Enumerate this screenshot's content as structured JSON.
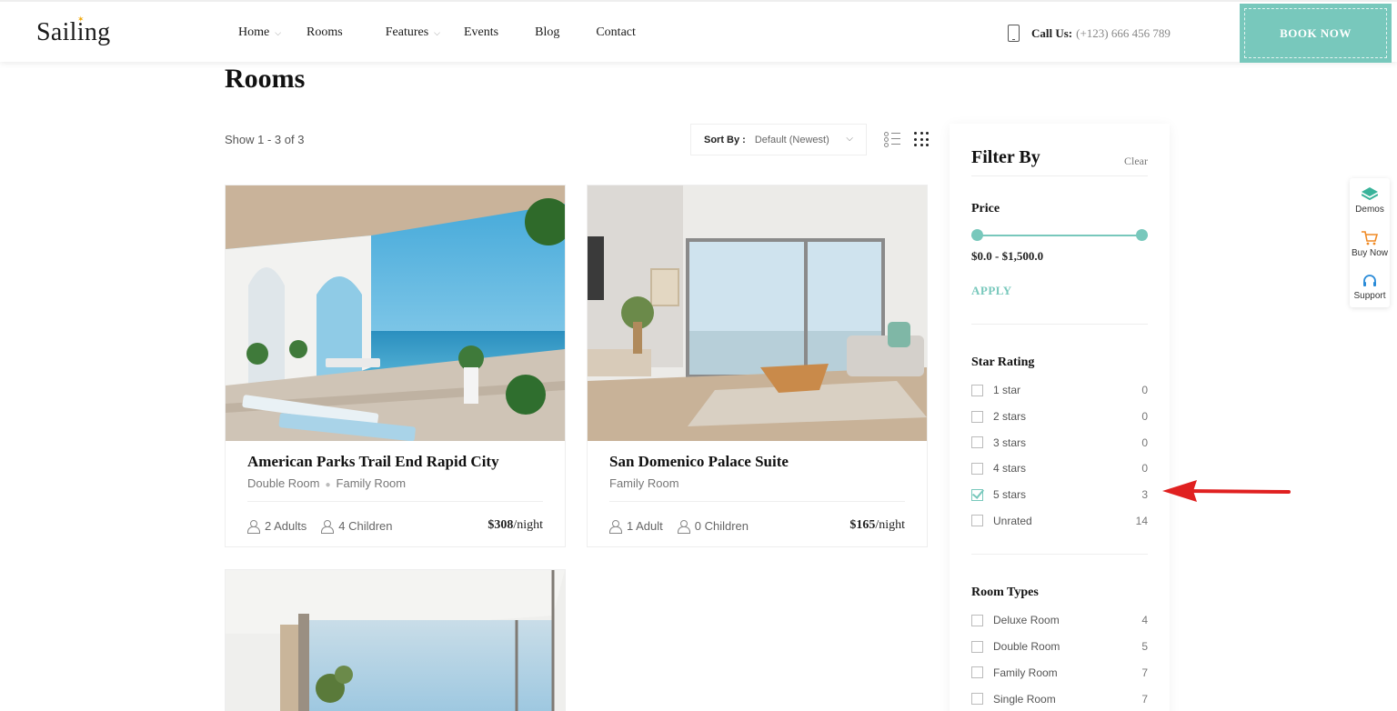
{
  "header": {
    "logo": "Sailing",
    "nav": [
      {
        "label": "Home",
        "dropdown": true
      },
      {
        "label": "Rooms",
        "dropdown": false
      },
      {
        "label": "Features",
        "dropdown": true
      },
      {
        "label": "Events",
        "dropdown": false
      },
      {
        "label": "Blog",
        "dropdown": false
      },
      {
        "label": "Contact",
        "dropdown": false
      }
    ],
    "call_label": "Call Us:",
    "call_number": "(+123) 666 456 789",
    "book_now": "BOOK NOW"
  },
  "page": {
    "title": "Rooms",
    "show_count": "Show 1 - 3 of 3",
    "sort_label": "Sort By :",
    "sort_value": "Default (Newest)"
  },
  "rooms": [
    {
      "title": "American Parks Trail End Rapid City",
      "types": [
        "Double Room",
        "Family Room"
      ],
      "adults": "2 Adults",
      "children": "4 Children",
      "price": "$308",
      "per": "/night"
    },
    {
      "title": "San Domenico Palace Suite",
      "types": [
        "Family Room"
      ],
      "adults": "1 Adult",
      "children": "0 Children",
      "price": "$165",
      "per": "/night"
    }
  ],
  "filter": {
    "title": "Filter By",
    "clear": "Clear",
    "price": {
      "title": "Price",
      "range": "$0.0 - $1,500.0",
      "apply": "APPLY",
      "min_fraction": 0,
      "max_fraction": 1
    },
    "star_rating": {
      "title": "Star Rating",
      "options": [
        {
          "label": "1 star",
          "count": "0",
          "checked": false
        },
        {
          "label": "2 stars",
          "count": "0",
          "checked": false
        },
        {
          "label": "3 stars",
          "count": "0",
          "checked": false
        },
        {
          "label": "4 stars",
          "count": "0",
          "checked": false
        },
        {
          "label": "5 stars",
          "count": "3",
          "checked": true
        },
        {
          "label": "Unrated",
          "count": "14",
          "checked": false
        }
      ]
    },
    "room_types": {
      "title": "Room Types",
      "options": [
        {
          "label": "Deluxe Room",
          "count": "4",
          "checked": false
        },
        {
          "label": "Double Room",
          "count": "5",
          "checked": false
        },
        {
          "label": "Family Room",
          "count": "7",
          "checked": false
        },
        {
          "label": "Single Room",
          "count": "7",
          "checked": false
        }
      ]
    }
  },
  "side_tools": [
    {
      "label": "Demos",
      "icon": "layers-icon"
    },
    {
      "label": "Buy Now",
      "icon": "cart-icon"
    },
    {
      "label": "Support",
      "icon": "headset-icon"
    }
  ],
  "colors": {
    "accent": "#78c8bc",
    "annotation_arrow": "#e02020"
  }
}
